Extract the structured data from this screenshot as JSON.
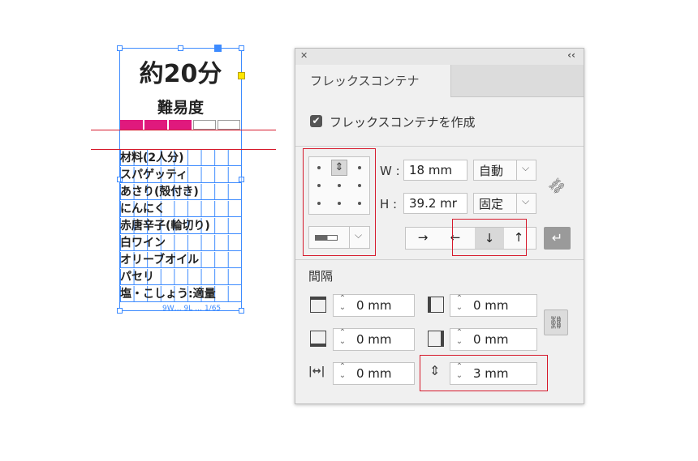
{
  "artwork": {
    "title": "約20分",
    "subtitle": "難易度",
    "difficulty": {
      "filled": 3,
      "total": 5,
      "filled_color": "#e0197d"
    },
    "ingredients": [
      "材料(2人分)",
      "スパゲッティ",
      "あさり(殻付き)",
      "にんにく",
      "赤唐辛子(輪切り)",
      "白ワイン",
      "オリーブオイル",
      "パセリ",
      "塩・こしょう:適量"
    ],
    "footer": "9W… 9L … 1/65"
  },
  "panel": {
    "close_glyph": "✕",
    "collapse_glyph": "‹‹",
    "tab": "フレックスコンテナ",
    "create_checkbox": {
      "label": "フレックスコンテナを作成",
      "checked": true
    },
    "width": {
      "label": "W :",
      "value": "18 mm",
      "mode": "自動"
    },
    "height": {
      "label": "H :",
      "value": "39.2 mr",
      "mode": "固定"
    },
    "direction_arrows": [
      "→",
      "←",
      "↓",
      "↑"
    ],
    "wrap_glyph": "↵",
    "spacing_label": "間隔",
    "padding": {
      "top": "0 mm",
      "left": "0 mm",
      "bottom": "0 mm",
      "right": "0 mm"
    },
    "gap_horizontal": "0 mm",
    "gap_vertical": "3 mm",
    "highlight_color": "#d61a2c"
  }
}
